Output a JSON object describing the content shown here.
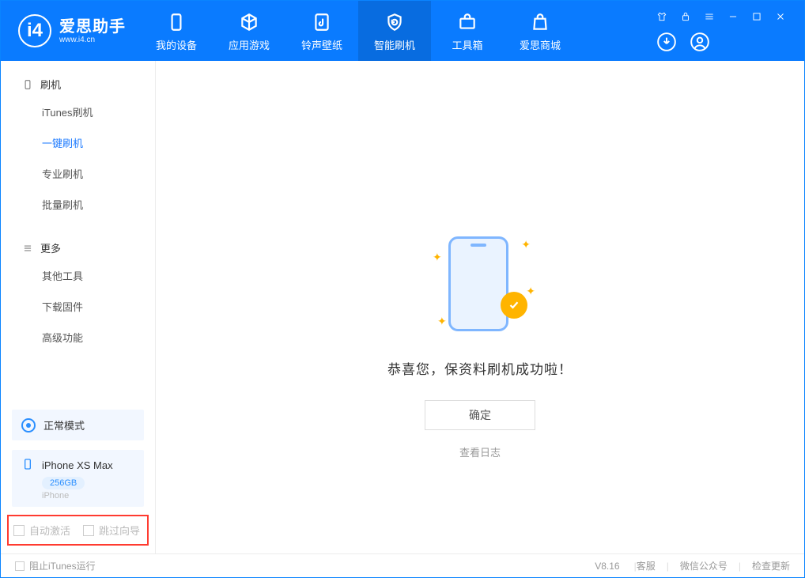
{
  "logo": {
    "title": "爱思助手",
    "subtitle": "www.i4.cn",
    "mark": "i4"
  },
  "tabs": [
    {
      "label": "我的设备"
    },
    {
      "label": "应用游戏"
    },
    {
      "label": "铃声壁纸"
    },
    {
      "label": "智能刷机"
    },
    {
      "label": "工具箱"
    },
    {
      "label": "爱思商城"
    }
  ],
  "sidebar": {
    "flash": {
      "title": "刷机",
      "items": [
        "iTunes刷机",
        "一键刷机",
        "专业刷机",
        "批量刷机"
      ],
      "active_index": 1
    },
    "more": {
      "title": "更多",
      "items": [
        "其他工具",
        "下载固件",
        "高级功能"
      ]
    }
  },
  "device": {
    "mode_label": "正常模式",
    "name": "iPhone XS Max",
    "storage": "256GB",
    "type": "iPhone"
  },
  "options": {
    "auto_activate": "自动激活",
    "skip_guide": "跳过向导"
  },
  "main": {
    "success_title": "恭喜您，保资料刷机成功啦！",
    "ok": "确定",
    "view_log": "查看日志"
  },
  "status": {
    "block_itunes": "阻止iTunes运行",
    "version": "V8.16",
    "support": "客服",
    "wechat": "微信公众号",
    "update": "检查更新"
  }
}
